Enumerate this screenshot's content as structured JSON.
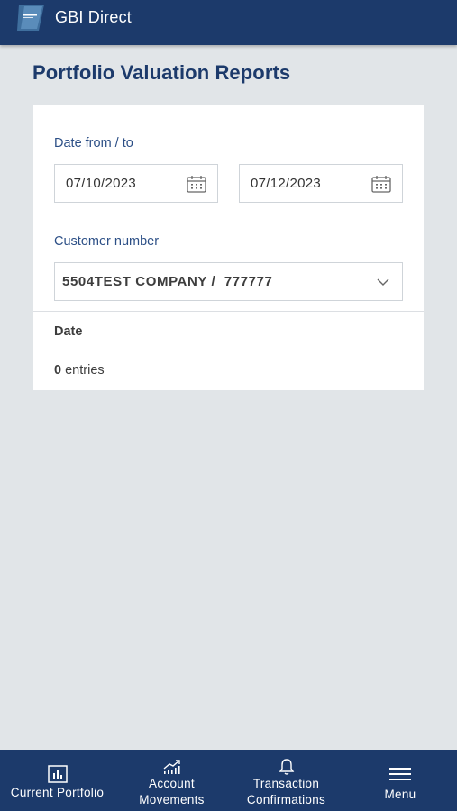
{
  "header": {
    "app_title": "GBI Direct",
    "logo_icon": "gbi-logo-icon"
  },
  "page": {
    "title": "Portfolio Valuation Reports"
  },
  "form": {
    "date_label": "Date from / to",
    "date_from": "07/10/2023",
    "date_to": "07/12/2023",
    "customer_label": "Customer number",
    "customer_value": "5504TEST COMPANY /  777777"
  },
  "table": {
    "columns": [
      "Date"
    ],
    "entries_count": "0",
    "entries_suffix": " entries"
  },
  "bottom_nav": {
    "items": [
      {
        "label": "Current Portfolio",
        "icon": "bar-chart-icon"
      },
      {
        "label_line1": "Account",
        "label_line2": "Movements",
        "icon": "trend-chart-icon"
      },
      {
        "label_line1": "Transaction",
        "label_line2": "Confirmations",
        "icon": "bell-icon"
      },
      {
        "label": "Menu",
        "icon": "hamburger-icon"
      }
    ]
  },
  "colors": {
    "primary": "#1c3a6b",
    "background": "#e1e5e8",
    "label": "#2c4f86"
  }
}
